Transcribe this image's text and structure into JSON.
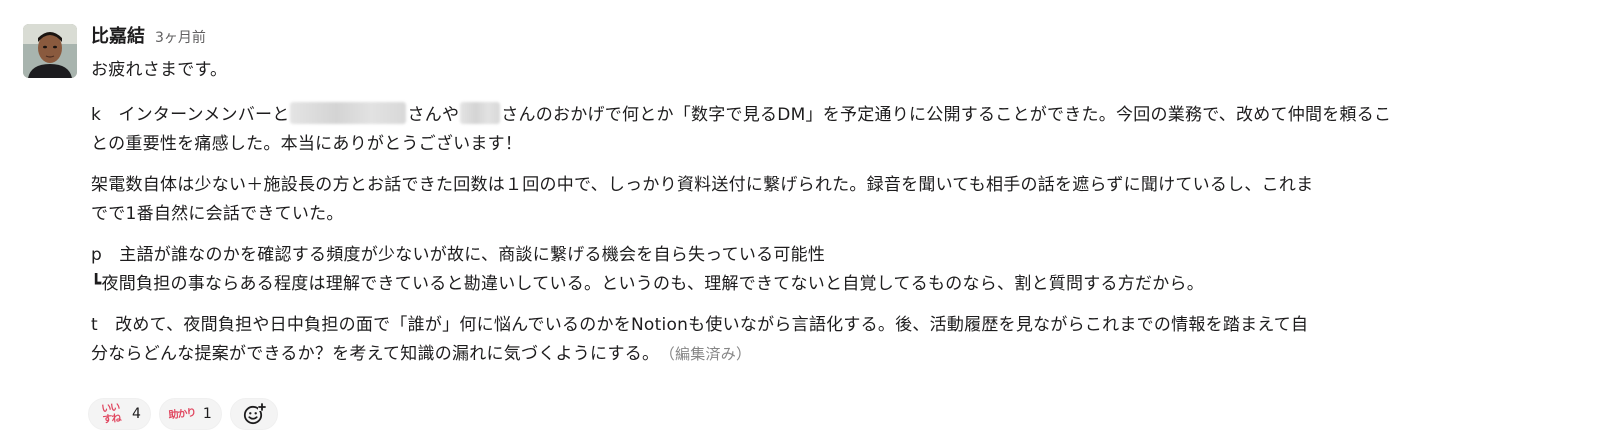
{
  "message": {
    "sender": "比嘉結",
    "timestamp": "3ヶ月前",
    "greeting": "お疲れさまです。",
    "k_line1_a": "k　インターンメンバーと",
    "k_line1_b": "さんや",
    "k_line1_c": "さんのおかげで何とか「数字で見るDM」を予定通りに公開することができた。今回の業務で、改めて仲間を頼るこ",
    "k_line2": "との重要性を痛感した。本当にありがとうございます！",
    "call_line1": "架電数自体は少ない＋施設長の方とお話できた回数は１回の中で、しっかり資料送付に繋げられた。録音を聞いても相手の話を遮らずに聞けているし、これま",
    "call_line2": "でで1番自然に会話できていた。",
    "p_line1": "p　主語が誰なのかを確認する頻度が少ないが故に、商談に繋げる機会を自ら失っている可能性",
    "p_line2": "┗夜間負担の事ならある程度は理解できていると勘違いしている。というのも、理解できてないと自覚してるものなら、割と質問する方だから。",
    "t_line1": "t　改めて、夜間負担や日中負担の面で「誰が」何に悩んでいるのかをNotionも使いながら言語化する。後、活動履歴を見ながらこれまでの情報を踏まえて自",
    "t_line2": "分ならどんな提案ができるか？を考えて知識の漏れに気づくようにする。",
    "edited": "（編集済み）"
  },
  "reactions": [
    {
      "emoji_text_top": "いい",
      "emoji_text_bottom": "すね",
      "count": "4"
    },
    {
      "emoji_text_top": "助かり",
      "emoji_text_bottom": "",
      "count": "1"
    }
  ],
  "colors": {
    "text": "#1d1c1d",
    "muted": "#616061",
    "reaction_bg": "#f4f4f4",
    "stamp_red": "#e0465f"
  },
  "icons": {
    "add_reaction": "smiley-plus-icon"
  }
}
